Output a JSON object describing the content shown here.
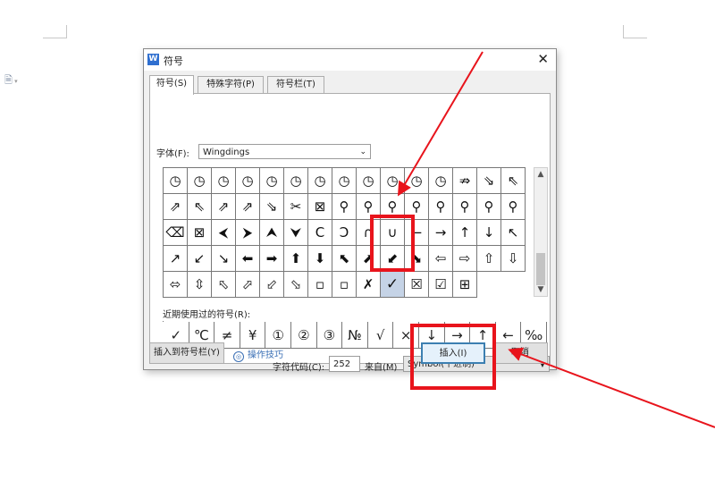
{
  "dialog": {
    "title": "符号",
    "app_icon": "W",
    "close": "✕",
    "tabs": [
      "符号(S)",
      "特殊字符(P)",
      "符号栏(T)"
    ],
    "font_label": "字体(F):",
    "font_value": "Wingdings",
    "symbol_grid": [
      [
        "◷",
        "◷",
        "◷",
        "◷",
        "◷",
        "◷",
        "◷",
        "◷",
        "◷",
        "◷",
        "◷",
        "◷",
        "⇏",
        "⇘",
        "⇖"
      ],
      [
        "⇗",
        "⇖",
        "⇗",
        "⇗",
        "⇘",
        "✂",
        "⊠",
        "⚲",
        "⚲",
        "⚲",
        "⚲",
        "⚲",
        "⚲",
        "⚲",
        "⚲"
      ],
      [
        "⌫",
        "⊠",
        "⮜",
        "⮞",
        "⮝",
        "⮟",
        "C",
        "Ↄ",
        "∩",
        "∪",
        "←",
        "→",
        "↑",
        "↓",
        "↖"
      ],
      [
        "↗",
        "↙",
        "↘",
        "⬅",
        "➡",
        "⬆",
        "⬇",
        "⬉",
        "⬈",
        "⬋",
        "⬊",
        "⇦",
        "⇨",
        "⇧",
        "⇩"
      ],
      [
        "⬄",
        "⇳",
        "⬁",
        "⬀",
        "⬃",
        "⬂",
        "▫",
        "▫",
        "✗",
        "✓",
        "☒",
        "☑",
        "⊞"
      ]
    ],
    "selected_symbol": "✓",
    "recent_label": "近期使用过的符号(R):",
    "recent_symbols": [
      "✓",
      "℃",
      "≠",
      "¥",
      "①",
      "②",
      "③",
      "№",
      "√",
      "×",
      "↓",
      "→",
      "↑",
      "←",
      "‰"
    ],
    "char_code_label": "字符代码(C):",
    "char_code_value": "252",
    "from_label": "来自(M)",
    "from_value": "Symbol(十进制)",
    "insert_to_bar_button": "插入到符号栏(Y)",
    "tips_link": "操作技巧",
    "insert_button": "插入(I)",
    "cancel_button": "取消"
  },
  "annotation_color": "#e8141c"
}
